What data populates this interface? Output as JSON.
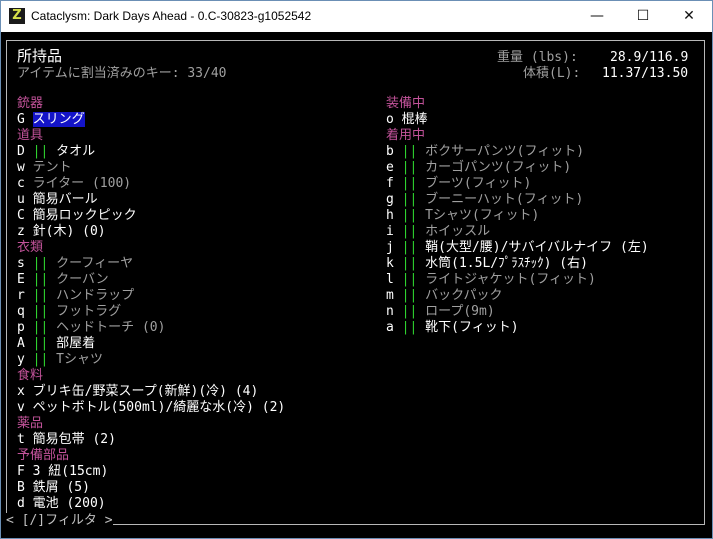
{
  "window": {
    "title": "Cataclysm: Dark Days Ahead - 0.C-30823-g1052542",
    "icon_glyph": "Z",
    "controls": {
      "minimize": "—",
      "maximize": "☐",
      "close": "✕"
    }
  },
  "header": {
    "title": "所持品",
    "keys_info": "アイテムに割当済みのキー: 33/40",
    "weight_label": "重量 (lbs):",
    "weight_value": "28.9/116.9",
    "volume_label": "体積(L):",
    "volume_value": "11.37/13.50"
  },
  "left": [
    {
      "type": "cat",
      "text": "銃器"
    },
    {
      "type": "item",
      "key": "G",
      "bar": "",
      "name": "スリング",
      "selected": true
    },
    {
      "type": "cat",
      "text": "道具"
    },
    {
      "type": "item",
      "key": "D",
      "bar": "||",
      "name": "タオル"
    },
    {
      "type": "item",
      "key": "w",
      "bar": "",
      "name": "テント",
      "gray": true
    },
    {
      "type": "item",
      "key": "c",
      "bar": "",
      "name": "ライター (100)",
      "gray": true
    },
    {
      "type": "item",
      "key": "u",
      "bar": "",
      "name": "簡易バール"
    },
    {
      "type": "item",
      "key": "C",
      "bar": "",
      "name": "簡易ロックピック"
    },
    {
      "type": "item",
      "key": "z",
      "bar": "",
      "name": "針(木) (0)"
    },
    {
      "type": "cat",
      "text": "衣類"
    },
    {
      "type": "item",
      "key": "s",
      "bar": "||",
      "name": "クーフィーヤ",
      "gray": true
    },
    {
      "type": "item",
      "key": "E",
      "bar": "||",
      "name": "クーバン",
      "gray": true
    },
    {
      "type": "item",
      "key": "r",
      "bar": "||",
      "name": "ハンドラップ",
      "gray": true
    },
    {
      "type": "item",
      "key": "q",
      "bar": "||",
      "name": "フットラグ",
      "gray": true
    },
    {
      "type": "item",
      "key": "p",
      "bar": "||",
      "name": "ヘッドトーチ (0)",
      "gray": true
    },
    {
      "type": "item",
      "key": "A",
      "bar": "||",
      "name": "部屋着"
    },
    {
      "type": "item",
      "key": "y",
      "bar": "||",
      "name": "Tシャツ",
      "gray": true
    },
    {
      "type": "cat",
      "text": "食料"
    },
    {
      "type": "item",
      "key": "x",
      "bar": "",
      "name": "ブリキ缶/野菜スープ(新鮮)(冷) (4)"
    },
    {
      "type": "item",
      "key": "v",
      "bar": "",
      "name": "ペットボトル(500ml)/綺麗な水(冷) (2)"
    },
    {
      "type": "cat",
      "text": "薬品"
    },
    {
      "type": "item",
      "key": "t",
      "bar": "",
      "name": "簡易包帯 (2)"
    },
    {
      "type": "cat",
      "text": "予備部品"
    },
    {
      "type": "item",
      "key": "F",
      "bar": "",
      "name": "3 紐(15cm)"
    },
    {
      "type": "item",
      "key": "B",
      "bar": "",
      "name": "鉄屑 (5)"
    },
    {
      "type": "item",
      "key": "d",
      "bar": "",
      "name": "電池 (200)"
    }
  ],
  "right": [
    {
      "type": "cat",
      "text": "装備中"
    },
    {
      "type": "item",
      "key": "o",
      "bar": "",
      "name": "棍棒"
    },
    {
      "type": "cat",
      "text": "着用中"
    },
    {
      "type": "item",
      "key": "b",
      "bar": "||",
      "name": "ボクサーパンツ(フィット)",
      "gray": true
    },
    {
      "type": "item",
      "key": "e",
      "bar": "||",
      "name": "カーゴパンツ(フィット)",
      "gray": true
    },
    {
      "type": "item",
      "key": "f",
      "bar": "||",
      "name": "ブーツ(フィット)",
      "gray": true
    },
    {
      "type": "item",
      "key": "g",
      "bar": "||",
      "name": "ブーニーハット(フィット)",
      "gray": true
    },
    {
      "type": "item",
      "key": "h",
      "bar": "||",
      "name": "Tシャツ(フィット)",
      "gray": true
    },
    {
      "type": "item",
      "key": "i",
      "bar": "||",
      "name": "ホイッスル",
      "gray": true
    },
    {
      "type": "item",
      "key": "j",
      "bar": "||",
      "name": "鞘(大型/腰)/サバイバルナイフ (左)"
    },
    {
      "type": "item",
      "key": "k",
      "bar": "||",
      "name": "水筒(1.5L/ﾌﾟﾗｽﾁｯｸ) (右)"
    },
    {
      "type": "item",
      "key": "l",
      "bar": "||",
      "name": "ライトジャケット(フィット)",
      "gray": true
    },
    {
      "type": "item",
      "key": "m",
      "bar": "||",
      "name": "バックパック",
      "gray": true
    },
    {
      "type": "item",
      "key": "n",
      "bar": "||",
      "name": "ロープ(9m)",
      "gray": true
    },
    {
      "type": "item",
      "key": "a",
      "bar": "||",
      "name": "靴下(フィット)"
    }
  ],
  "footer": {
    "filter": "< [/]フィルタ >"
  }
}
